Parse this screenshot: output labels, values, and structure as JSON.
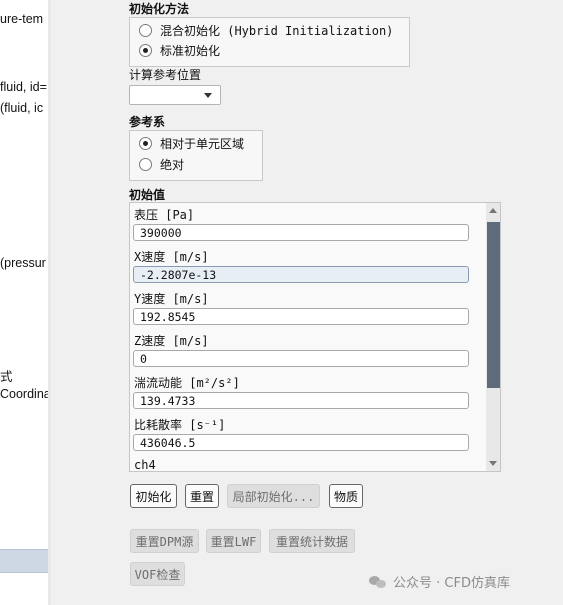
{
  "left_tree": {
    "lines": [
      "ure-tem",
      "fluid, id=",
      "(fluid, ic",
      "(pressur",
      "式",
      "Coordina"
    ]
  },
  "init_method": {
    "title": "初始化方法",
    "options": [
      {
        "label": "混合初始化 (Hybrid Initialization)",
        "checked": false
      },
      {
        "label": "标准初始化",
        "checked": true
      }
    ]
  },
  "compute_from": {
    "label": "计算参考位置",
    "selected": ""
  },
  "reference_frame": {
    "title": "参考系",
    "options": [
      {
        "label": "相对于单元区域",
        "checked": true
      },
      {
        "label": "绝对",
        "checked": false
      }
    ]
  },
  "initial_values": {
    "title": "初始值",
    "fields": [
      {
        "label": "表压 [Pa]",
        "value": "390000"
      },
      {
        "label": "X速度 [m/s]",
        "value": "-2.2807e-13"
      },
      {
        "label": "Y速度 [m/s]",
        "value": "192.8545"
      },
      {
        "label": "Z速度 [m/s]",
        "value": "0"
      },
      {
        "label": "湍流动能 [m²/s²]",
        "value": "139.4733"
      },
      {
        "label": "比耗散率 [s⁻¹]",
        "value": "436046.5"
      },
      {
        "label": "ch4",
        "value": ""
      }
    ]
  },
  "buttons": {
    "initialize": "初始化",
    "reset": "重置",
    "patch": "局部初始化...",
    "material": "物质",
    "reset_dpm": "重置DPM源",
    "reset_lwf": "重置LWF",
    "reset_stats": "重置统计数据",
    "vof_check": "VOF检查"
  },
  "watermark": {
    "text": "公众号 · CFD仿真库"
  }
}
